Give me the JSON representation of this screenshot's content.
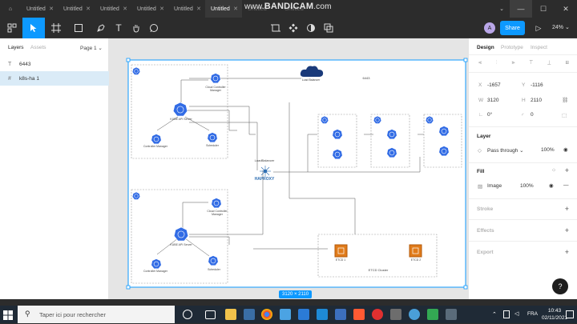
{
  "window": {
    "tabs": [
      {
        "label": "Untitled",
        "active": false
      },
      {
        "label": "Untitled",
        "active": false
      },
      {
        "label": "Untitled",
        "active": false
      },
      {
        "label": "Untitled",
        "active": false
      },
      {
        "label": "Untitled",
        "active": false
      },
      {
        "label": "Untitled",
        "active": true
      },
      {
        "label": "Untitled",
        "active": false
      },
      {
        "label": "Untitled",
        "active": false
      }
    ],
    "watermark_prefix": "www.",
    "watermark_brand": "BANDICAM",
    "watermark_suffix": ".com"
  },
  "toolbar": {
    "tools": [
      "main-menu-icon",
      "move-icon",
      "frame-icon",
      "shape-icon",
      "pen-icon",
      "text-icon",
      "hand-icon",
      "comment-icon"
    ],
    "center_tools": [
      "crop-icon",
      "component-icon",
      "mask-icon",
      "boolean-icon"
    ],
    "avatar_initial": "A",
    "share_label": "Share",
    "play_icon": "play-icon",
    "zoom": "24%"
  },
  "left_panel": {
    "tab_layers": "Layers",
    "tab_assets": "Assets",
    "page_selector": "Page 1",
    "layers": [
      {
        "icon": "T",
        "name": "6443",
        "selected": false
      },
      {
        "icon": "#",
        "name": "k8s-ha 1",
        "selected": true
      }
    ]
  },
  "canvas": {
    "frame_size_badge": "3120 × 2110",
    "labels": {
      "cloud": "Load Balancer",
      "port": "6443",
      "lb_label": "LoadBalancer",
      "haproxy": "HAPROXY",
      "api1": "KUBE API Server",
      "cm1": "Cloud Controller Manager",
      "ctrl1": "Controller Manager",
      "sched1": "Scheduler",
      "api2": "KUBE API Server",
      "cm2": "Cloud Controller Manager",
      "ctrl2": "Controller Manager",
      "sched2": "Scheduler",
      "etcd1": "ETCD 1",
      "etcd2": "ETCD 2",
      "etcd_cluster": "ETCD Cluster"
    }
  },
  "right_panel": {
    "tab_design": "Design",
    "tab_prototype": "Prototype",
    "tab_inspect": "Inspect",
    "x_label": "X",
    "x_value": "-1657",
    "y_label": "Y",
    "y_value": "-1116",
    "w_label": "W",
    "w_value": "3120",
    "h_label": "H",
    "h_value": "2110",
    "rotation": "0°",
    "radius": "0",
    "layer_title": "Layer",
    "blend_mode": "Pass through",
    "layer_opacity": "100%",
    "fill_title": "Fill",
    "fill_type": "Image",
    "fill_opacity": "100%",
    "stroke_title": "Stroke",
    "effects_title": "Effects",
    "export_title": "Export",
    "help": "?"
  },
  "taskbar": {
    "search_placeholder": "Taper ici pour rechercher",
    "lang": "FRA",
    "time": "10:43",
    "date": "02/11/2021"
  }
}
